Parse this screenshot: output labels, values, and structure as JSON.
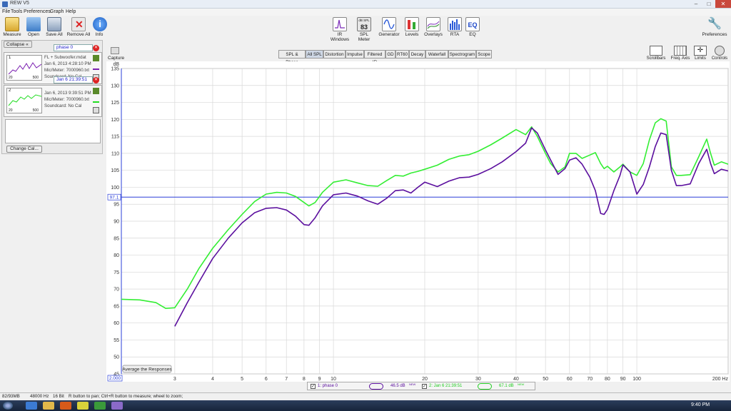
{
  "window": {
    "title": "REW V5",
    "controls": [
      "–",
      "□",
      "✕"
    ]
  },
  "menu": [
    "File",
    "Tools",
    "Preferences",
    "Graph",
    "Help"
  ],
  "toolbar": {
    "left": [
      {
        "label": "Measure",
        "icon": "measure-icon"
      },
      {
        "label": "Open",
        "icon": "open-icon"
      },
      {
        "label": "Save All",
        "icon": "save-all-icon"
      },
      {
        "label": "Remove All",
        "icon": "remove-all-icon"
      },
      {
        "label": "Info",
        "icon": "info-icon"
      }
    ],
    "center": [
      {
        "label": "IR Windows",
        "icon": "ir-windows-icon"
      },
      {
        "label": "SPL Meter",
        "icon": "spl-meter-icon",
        "readout_top": "dB SPL",
        "readout_value": "83"
      },
      {
        "label": "Generator",
        "icon": "generator-icon"
      },
      {
        "label": "Levels",
        "icon": "levels-icon"
      },
      {
        "label": "Overlays",
        "icon": "overlays-icon"
      },
      {
        "label": "RTA",
        "icon": "rta-icon"
      },
      {
        "label": "EQ",
        "icon": "eq-icon",
        "glyph": "EQ"
      }
    ],
    "right": {
      "label": "Preferences",
      "icon": "wrench-icon"
    }
  },
  "panel": {
    "collapse_label": "Collapse",
    "measurements": [
      {
        "index": "1",
        "name": "phase 0",
        "lines": [
          "FL + Subwoofer.mdat",
          "Jan 6, 2013 4:28:10 PM",
          "Mic/Meter: 7000960.txt",
          "Soundcard: No Cal"
        ],
        "thumb_ticks": [
          "20",
          "500"
        ],
        "color": "#7a1fb0"
      },
      {
        "index": "2",
        "name": "Jan 6 21:39:51",
        "lines": [
          "Jan 6, 2013 9:39:51 PM",
          "Mic/Meter: 7000960.txt",
          "Soundcard: No Cal"
        ],
        "thumb_ticks": [
          "20",
          "500"
        ],
        "color": "#22dd22"
      }
    ],
    "change_cal_label": "Change Cal..."
  },
  "capture_label": "Capture",
  "tabs": [
    "SPL & Phase",
    "All SPL",
    "Distortion",
    "Impulse",
    "Filtered IR",
    "GD",
    "RT60",
    "Decay",
    "Waterfall",
    "Spectrogram",
    "Scope"
  ],
  "active_tab": "All SPL",
  "right_tools": [
    "Scrollbars",
    "Freq. Axis",
    "Limits",
    "Controls"
  ],
  "average_button": "Average the Responses",
  "cursor_value": "97.1",
  "x_start_value": "2.000",
  "chart_data": {
    "type": "line",
    "x_scale": "log",
    "xlim": [
      2,
      200
    ],
    "ylim": [
      45,
      135
    ],
    "ylabel": "dB",
    "xlabel_unit": "Hz",
    "yticks": [
      45,
      50,
      55,
      60,
      65,
      70,
      75,
      80,
      85,
      90,
      95,
      100,
      105,
      110,
      115,
      120,
      125,
      130,
      135
    ],
    "xticks": [
      3,
      4,
      5,
      6,
      7,
      8,
      9,
      10,
      20,
      30,
      40,
      50,
      60,
      70,
      80,
      90,
      100
    ],
    "xtick_labels": [
      "3",
      "4",
      "5",
      "6",
      "7",
      "8",
      "9",
      "10",
      "20",
      "30",
      "40",
      "50",
      "60",
      "70",
      "80",
      "90",
      "100",
      "200 Hz"
    ],
    "hline": 97.1,
    "grid": true,
    "series": [
      {
        "name": "1: phase 0",
        "color": "#5b0f9e",
        "x": [
          3.0,
          3.3,
          3.6,
          4.0,
          4.5,
          5.0,
          5.5,
          6.0,
          6.5,
          7.0,
          7.5,
          8.0,
          8.3,
          8.7,
          9.2,
          10,
          11,
          12,
          13,
          14,
          15,
          16,
          17,
          18,
          19,
          20,
          22,
          24,
          26,
          28,
          30,
          33,
          36,
          40,
          43,
          45,
          47,
          50,
          52,
          55,
          58,
          60,
          63,
          66,
          70,
          73,
          76,
          78,
          80,
          84,
          88,
          90,
          95,
          100,
          105,
          110,
          115,
          120,
          125,
          130,
          135,
          140,
          150,
          160,
          170,
          175,
          180,
          190,
          200
        ],
        "values": [
          59,
          66,
          72,
          79,
          85,
          89.5,
          92.5,
          93.8,
          94,
          93.3,
          91.5,
          89,
          88.8,
          91,
          94.5,
          97.8,
          98.3,
          97.4,
          96,
          95,
          96.8,
          99,
          99.2,
          98.3,
          100,
          101.5,
          100.2,
          101.8,
          102.8,
          103,
          103.8,
          105.5,
          107.5,
          110.5,
          113,
          117.5,
          116,
          111,
          108,
          103.8,
          105.5,
          108,
          108.7,
          106.8,
          103,
          99,
          92.3,
          92,
          93.5,
          99,
          103.5,
          106.6,
          104.5,
          98,
          100.8,
          106,
          112,
          116,
          115.5,
          105,
          100.5,
          100.5,
          101,
          107,
          111.2,
          107,
          104,
          105.3,
          104.8
        ]
      },
      {
        "name": "2: Jan 6 21:39:51",
        "color": "#33ee33",
        "x": [
          2.0,
          2.3,
          2.6,
          2.8,
          3.0,
          3.3,
          3.6,
          4.0,
          4.5,
          5.0,
          5.5,
          6.0,
          6.5,
          7.0,
          7.5,
          8.0,
          8.3,
          8.7,
          9.2,
          10,
          11,
          12,
          13,
          14,
          15,
          16,
          17,
          18,
          19,
          20,
          22,
          24,
          26,
          28,
          30,
          33,
          36,
          40,
          43,
          45,
          47,
          50,
          52,
          55,
          58,
          60,
          63,
          66,
          70,
          73,
          76,
          78,
          80,
          84,
          88,
          90,
          95,
          100,
          105,
          110,
          115,
          120,
          125,
          130,
          135,
          140,
          150,
          160,
          170,
          175,
          180,
          190,
          200
        ],
        "values": [
          67,
          66.8,
          66,
          64.3,
          64.5,
          70,
          76,
          82,
          87.5,
          92,
          95.8,
          98,
          98.5,
          98.3,
          97.3,
          95.5,
          94.5,
          95.5,
          98.5,
          101.5,
          102.2,
          101.3,
          100.5,
          100.3,
          102,
          103.5,
          103.3,
          104.2,
          104.7,
          105.3,
          106.5,
          108.2,
          109.2,
          109.6,
          110.6,
          112.5,
          114.5,
          117,
          115.5,
          117.8,
          115,
          110,
          107,
          104.5,
          106,
          110,
          110,
          108.5,
          109.5,
          110.2,
          107,
          105.5,
          106.2,
          104.5,
          106,
          106.8,
          104.5,
          103.5,
          107,
          114,
          119,
          120.2,
          119.5,
          106,
          103.5,
          103.5,
          103.7,
          109,
          114.2,
          110,
          106.5,
          107.5,
          106.8
        ]
      }
    ]
  },
  "legend": {
    "items": [
      {
        "label": "1: phase 0",
        "value": "46.5 dB",
        "sup": "NEW",
        "color": "#5b0f9e"
      },
      {
        "label": "2: Jan 6 21:39:51",
        "value": "67.1 dB",
        "sup": "NEW",
        "color": "#22dd22"
      }
    ]
  },
  "status": {
    "memory": "82/93MB",
    "rate": "48000 Hz",
    "bits": "16 Bit",
    "hint": "R button to pan; Ctrl+R button to measure; wheel to zoom;"
  },
  "taskbar": {
    "clock": "9:40 PM"
  }
}
